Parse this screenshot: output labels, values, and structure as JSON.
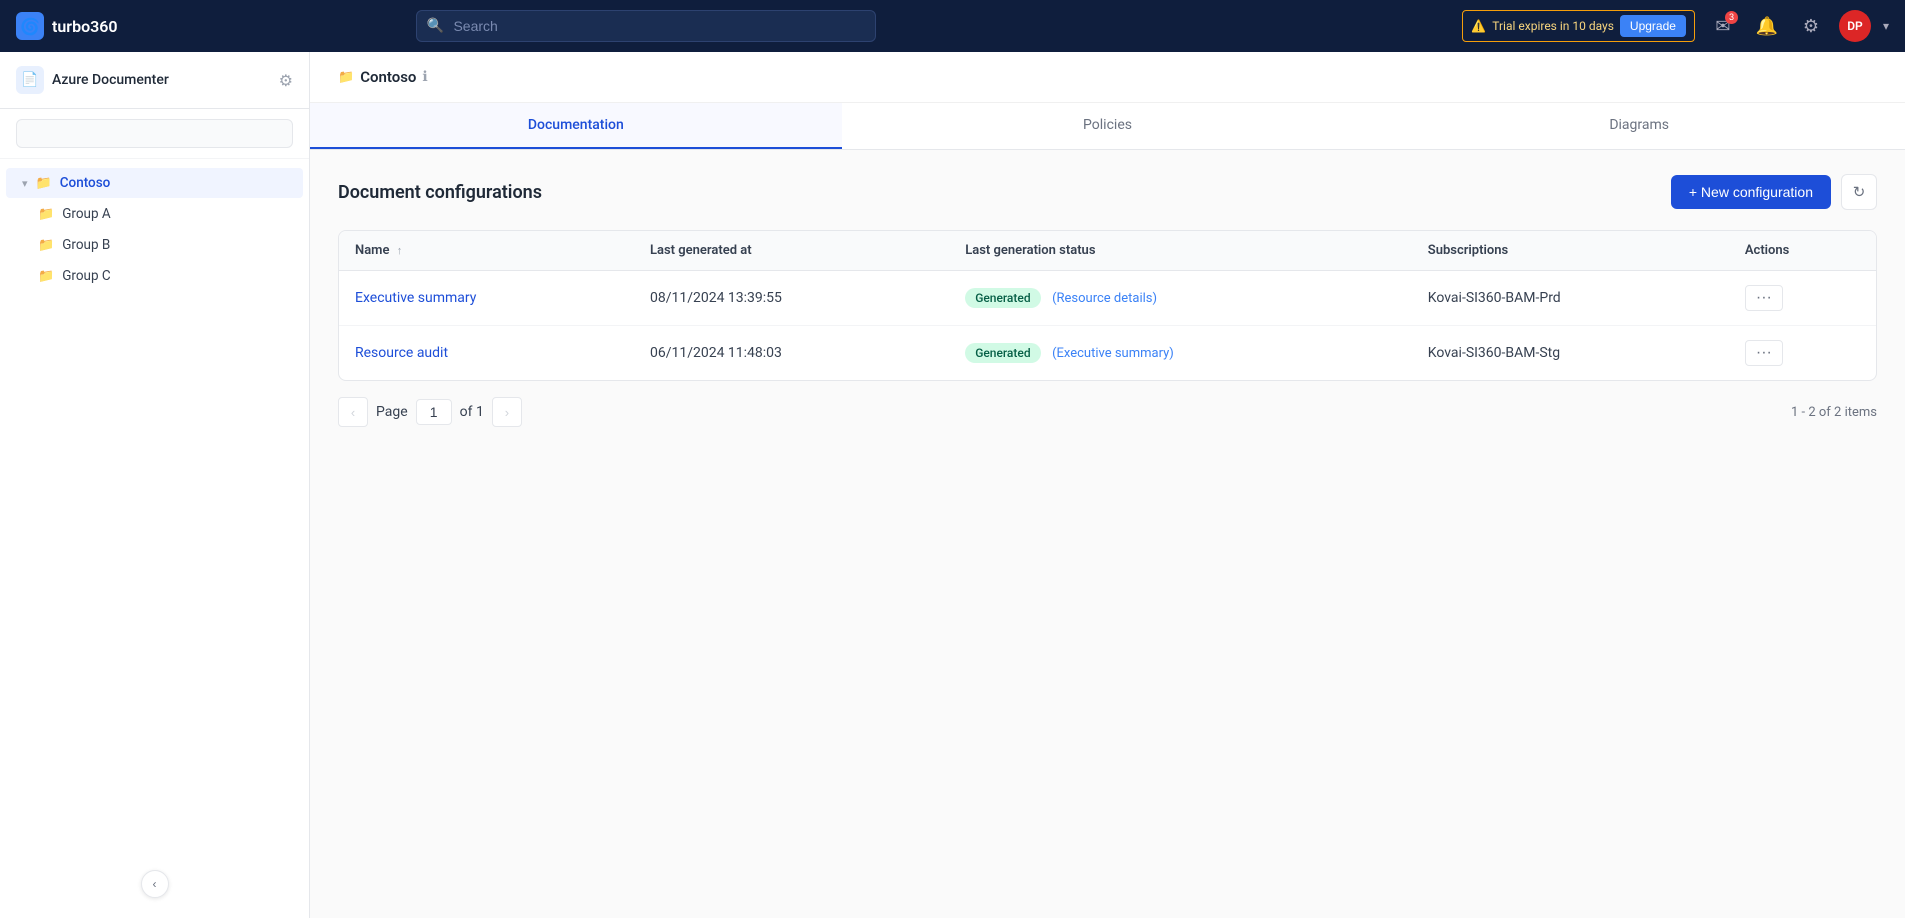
{
  "app": {
    "name": "turbo360",
    "logo_text": "turbo360"
  },
  "topnav": {
    "search_placeholder": "Search",
    "trial_text": "Trial expires in 10 days",
    "upgrade_label": "Upgrade",
    "notification_count": "3",
    "avatar_initials": "DP"
  },
  "sidebar": {
    "title": "Azure Documenter",
    "search_placeholder": "",
    "items": [
      {
        "label": "Contoso",
        "active": true,
        "expanded": true,
        "depth": 0
      },
      {
        "label": "Group A",
        "active": false,
        "depth": 1
      },
      {
        "label": "Group B",
        "active": false,
        "depth": 1
      },
      {
        "label": "Group C",
        "active": false,
        "depth": 1
      }
    ]
  },
  "breadcrumb": {
    "label": "Contoso"
  },
  "tabs": [
    {
      "label": "Documentation",
      "active": true
    },
    {
      "label": "Policies",
      "active": false
    },
    {
      "label": "Diagrams",
      "active": false
    }
  ],
  "content": {
    "title": "Document configurations",
    "new_config_label": "+ New configuration",
    "table": {
      "columns": [
        {
          "label": "Name",
          "sortable": true
        },
        {
          "label": "Last generated at",
          "sortable": false
        },
        {
          "label": "Last generation status",
          "sortable": false
        },
        {
          "label": "Subscriptions",
          "sortable": false
        },
        {
          "label": "Actions",
          "sortable": false
        }
      ],
      "rows": [
        {
          "name": "Executive summary",
          "last_generated": "08/11/2024 13:39:55",
          "status_badge": "Generated",
          "status_link": "(Resource details)",
          "subscription": "Kovai-SI360-BAM-Prd"
        },
        {
          "name": "Resource audit",
          "last_generated": "06/11/2024 11:48:03",
          "status_badge": "Generated",
          "status_link": "(Executive summary)",
          "subscription": "Kovai-SI360-BAM-Stg"
        }
      ]
    },
    "pagination": {
      "page_label": "Page",
      "page_current": "1",
      "page_of": "of 1",
      "items_summary": "1 - 2 of 2 items"
    }
  }
}
